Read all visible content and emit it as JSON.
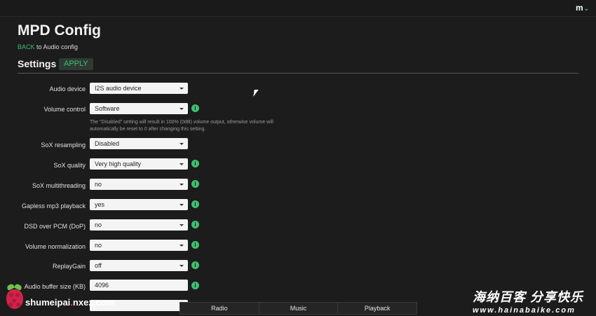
{
  "topbar": {
    "menu_label": "m",
    "menu_chevron": "⌄"
  },
  "page": {
    "title": "MPD Config",
    "back_link": "BACK",
    "back_text": " to Audio config"
  },
  "section": {
    "title": "Settings",
    "apply_label": "APPLY"
  },
  "rows": [
    {
      "label": "Audio device",
      "value": "I2S audio device",
      "info": false
    },
    {
      "label": "Volume control",
      "value": "Software",
      "info": true
    },
    {
      "label": "SoX resampling",
      "value": "Disabled",
      "info": false
    },
    {
      "label": "SoX quality",
      "value": "Very high quality",
      "info": true
    },
    {
      "label": "SoX multithreading",
      "value": "no",
      "info": true
    },
    {
      "label": "Gapless mp3 playback",
      "value": "yes",
      "info": true
    },
    {
      "label": "DSD over PCM (DoP)",
      "value": "no",
      "info": true
    },
    {
      "label": "Volume normalization",
      "value": "no",
      "info": true
    },
    {
      "label": "ReplayGain",
      "value": "off",
      "info": true
    },
    {
      "label": "Audio buffer size (KB)",
      "value": "4096",
      "info": true
    }
  ],
  "volume_help": "The \"Disabled\" setting will result in 100% (0dB) volume output, otherwise volume will automatically be reset to 0 after changing this setting.",
  "info_glyph": "i",
  "bottom_nav": {
    "radio": "Radio",
    "music": "Music",
    "playback": "Playback"
  },
  "watermark_left": {
    "name": "shumeipai",
    "dot": ".",
    "domain": "nxez.com"
  },
  "watermark_right": {
    "chinese": "海纳百客 分享快乐",
    "url": "www.hainabaike.com"
  },
  "colors": {
    "accent": "#3fbf6f",
    "background": "#1c1c1c"
  },
  "icons": {
    "info": "info-icon",
    "caret": "caret-down-icon",
    "cursor": "mouse-cursor-icon"
  }
}
